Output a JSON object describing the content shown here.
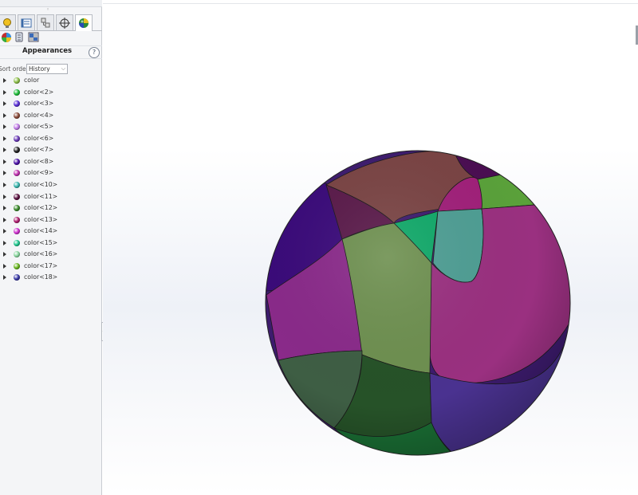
{
  "panel": {
    "tabs": [
      {
        "icon": "appearance-tab-bulb-icon",
        "label": ""
      },
      {
        "icon": "property-manager-icon",
        "label": ""
      },
      {
        "icon": "configuration-manager-icon",
        "label": ""
      },
      {
        "icon": "dimxpert-crosshair-icon",
        "label": ""
      },
      {
        "icon": "display-manager-sphere-icon",
        "label": ""
      }
    ],
    "subtools": [
      "appearances-icon",
      "decals-icon",
      "scenes-icon"
    ],
    "title": "Appearances",
    "help": "?",
    "sort_label": "Sort order:",
    "sort_value": "History",
    "items": [
      {
        "label": "color",
        "color": "#8fc04a"
      },
      {
        "label": "color<2>",
        "color": "#1fbf3a"
      },
      {
        "label": "color<3>",
        "color": "#5a2fd8"
      },
      {
        "label": "color<4>",
        "color": "#8a4a3a"
      },
      {
        "label": "color<5>",
        "color": "#c07ae8"
      },
      {
        "label": "color<6>",
        "color": "#6a3ab8"
      },
      {
        "label": "color<7>",
        "color": "#222222"
      },
      {
        "label": "color<8>",
        "color": "#4a10a8"
      },
      {
        "label": "color<9>",
        "color": "#c030b0"
      },
      {
        "label": "color<10>",
        "color": "#3ab8b0"
      },
      {
        "label": "color<11>",
        "color": "#5a1040"
      },
      {
        "label": "color<12>",
        "color": "#3a8a2a"
      },
      {
        "label": "color<13>",
        "color": "#b02070"
      },
      {
        "label": "color<14>",
        "color": "#d030d0"
      },
      {
        "label": "color<15>",
        "color": "#20c890"
      },
      {
        "label": "color<16>",
        "color": "#8ad8a0"
      },
      {
        "label": "color<17>",
        "color": "#6ab820"
      },
      {
        "label": "color<18>",
        "color": "#3a3aa8"
      }
    ]
  },
  "viewport": {
    "patch_colors": {
      "base": "#3d1b6e",
      "indigo": "#3a0a7a",
      "brown": "#7a4444",
      "maroon": "#5a1a4a",
      "dark_purple": "#4a0e52",
      "green_cap": "#5aa13a",
      "magenta_cap": "#a0207a",
      "teal": "#0fa868",
      "teal_oval": "#4e9e94",
      "magenta_main": "#9a3080",
      "violet_left": "#8a2a8a",
      "olive": "#6e9050",
      "sage": "#3e5e44",
      "dark_green": "#265228",
      "bottom_green": "#1a6e34",
      "purple_bottom": "#4a3290"
    }
  }
}
